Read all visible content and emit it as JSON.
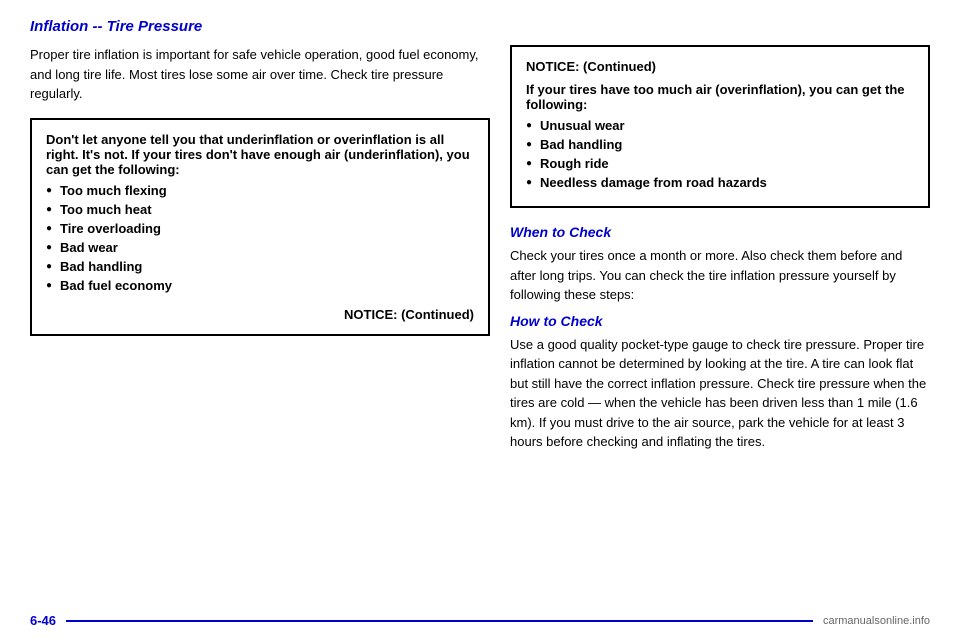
{
  "page": {
    "title": "Inflation -- Tire Pressure",
    "page_number": "6-46"
  },
  "left_column": {
    "intro_text": "Proper tire inflation is important for safe vehicle operation, good fuel economy, and long tire life. Most tires lose some air over time. Check tire pressure regularly.",
    "notice_box": {
      "intro_text": "Don't let anyone tell you that underinflation or overinflation is all right. It's not. If your tires don't have enough air (underinflation), you can get the following:",
      "bullet_items": [
        "Too much flexing",
        "Too much heat",
        "Tire overloading",
        "Bad wear",
        "Bad handling",
        "Bad fuel economy"
      ],
      "continued_label": "NOTICE: (Continued)"
    }
  },
  "right_column": {
    "notice_box": {
      "title": "NOTICE: (Continued)",
      "intro_text": "If your tires have too much air (overinflation), you can get the following:",
      "bullet_items": [
        "Unusual wear",
        "Bad handling",
        "Rough ride",
        "Needless damage from road hazards"
      ]
    },
    "when_to_check": {
      "heading": "When to Check",
      "body_text": "Check your tires once a month or more. Also check them before and after long trips. You can check the tire inflation pressure yourself by following these steps:"
    },
    "how_to_check": {
      "heading": "How to Check",
      "body_text": "Use a good quality pocket-type gauge to check tire pressure. Proper tire inflation cannot be determined by looking at the tire. A tire can look flat but still have the correct inflation pressure. Check tire pressure when the tires are cold — when the vehicle has been driven less than 1 mile (1.6 km). If you must drive to the air source, park the vehicle for at least 3 hours before checking and inflating the tires."
    }
  },
  "footer": {
    "logo_text": "carmanualsonline.info"
  }
}
